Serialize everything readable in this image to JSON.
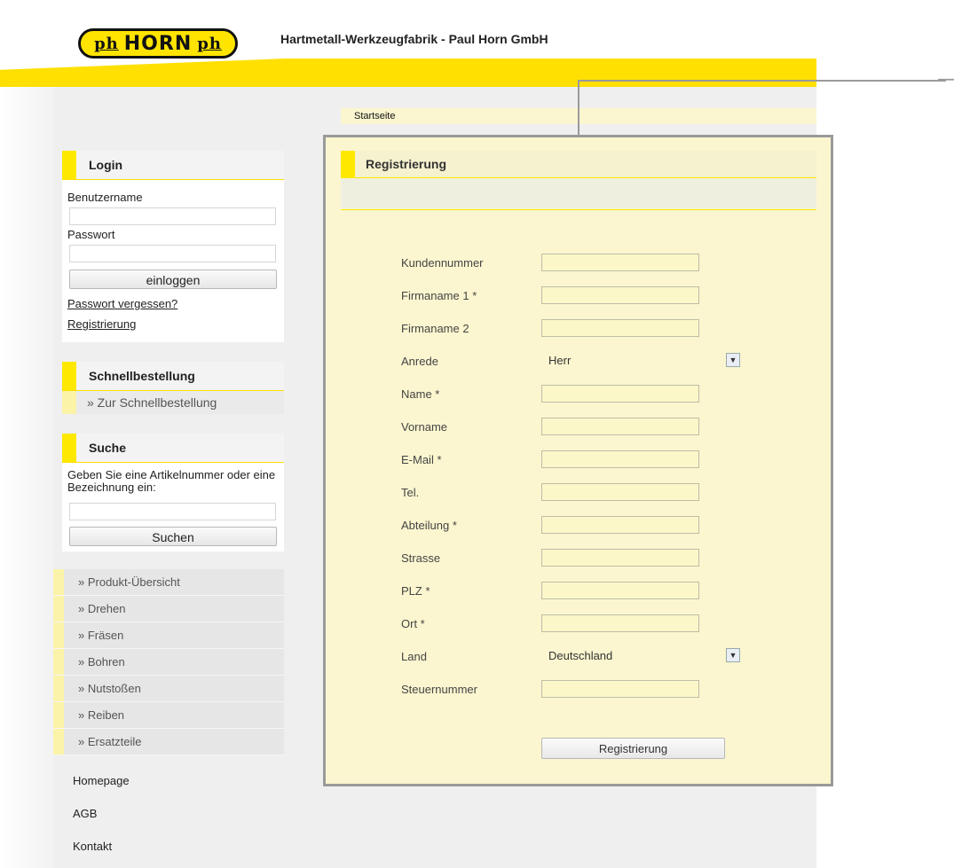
{
  "header": {
    "logo_text": "HORN",
    "logo_ph": "ph",
    "company": "Hartmetall-Werkzeugfabrik - Paul Horn GmbH"
  },
  "breadcrumb": "Startseite",
  "login": {
    "title": "Login",
    "username_label": "Benutzername",
    "password_label": "Passwort",
    "button": "einloggen",
    "forgot_link": "Passwort vergessen?",
    "register_link": "Registrierung"
  },
  "quick_order": {
    "title": "Schnellbestellung",
    "link": "» Zur Schnellbestellung"
  },
  "search": {
    "title": "Suche",
    "hint": "Geben Sie eine Artikelnummer oder eine Bezeichnung ein:",
    "button": "Suchen"
  },
  "nav": [
    "» Produkt-Übersicht",
    "» Drehen",
    "» Fräsen",
    "» Bohren",
    "» Nutstoßen",
    "» Reiben",
    "» Ersatzteile"
  ],
  "footer_links": [
    "Homepage",
    "AGB",
    "Kontakt"
  ],
  "registration": {
    "title": "Registrierung",
    "fields": [
      {
        "label": "Kundennummer",
        "type": "text",
        "value": ""
      },
      {
        "label": "Firmaname 1 *",
        "type": "text",
        "value": ""
      },
      {
        "label": "Firmaname 2",
        "type": "text",
        "value": ""
      },
      {
        "label": "Anrede",
        "type": "select",
        "value": "Herr"
      },
      {
        "label": "Name *",
        "type": "text",
        "value": ""
      },
      {
        "label": "Vorname",
        "type": "text",
        "value": ""
      },
      {
        "label": "E-Mail *",
        "type": "text",
        "value": ""
      },
      {
        "label": "Tel.",
        "type": "text",
        "value": ""
      },
      {
        "label": "Abteilung *",
        "type": "text",
        "value": ""
      },
      {
        "label": "Strasse",
        "type": "text",
        "value": ""
      },
      {
        "label": "PLZ *",
        "type": "text",
        "value": ""
      },
      {
        "label": "Ort *",
        "type": "text",
        "value": ""
      },
      {
        "label": "Land",
        "type": "select",
        "value": "Deutschland"
      },
      {
        "label": "Steuernummer",
        "type": "text",
        "value": ""
      }
    ],
    "submit": "Registrierung"
  },
  "icons": {
    "dropdown": "chevron-down-icon",
    "callout": "arrow-right-icon"
  },
  "colors": {
    "brand_yellow": "#ffe800",
    "panel_cream": "#fbf6cf",
    "frame_gray": "#9a9a9a"
  }
}
